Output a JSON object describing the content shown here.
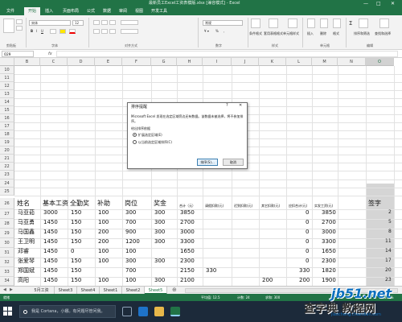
{
  "titlebar": {
    "title": "最新员工Excel工资表模版.xlsx [兼容模式] - Excel",
    "minimize": "—",
    "maximize": "□",
    "close": "✕"
  },
  "tabs": [
    "文件",
    "开始",
    "插入",
    "页面布局",
    "公式",
    "数据",
    "审阅",
    "视图",
    "开发工具"
  ],
  "ribbon": {
    "font_name": "宋体",
    "font_size": "12",
    "number_format": "常规",
    "groups": [
      "剪贴板",
      "字体",
      "对齐方式",
      "数字",
      "样式",
      "单元格",
      "编辑"
    ],
    "buttons": [
      "条件格式",
      "套用表格格式",
      "单元格样式",
      "插入",
      "删除",
      "格式",
      "排序和筛选",
      "查找和选择"
    ]
  },
  "formula_bar": {
    "name_box": "O29",
    "fx": "fx",
    "value": ""
  },
  "columns": [
    "B",
    "C",
    "D",
    "E",
    "F",
    "G",
    "H",
    "I",
    "J",
    "K",
    "L",
    "M",
    "N",
    "O"
  ],
  "selected_column": "O",
  "row_numbers": [
    "10",
    "11",
    "12",
    "13",
    "14",
    "15",
    "16",
    "17",
    "18",
    "19",
    "20",
    "21",
    "22",
    "23",
    "24",
    "25",
    "26",
    "27",
    "28",
    "29",
    "30",
    "31",
    "32",
    "33",
    "34",
    "35",
    "36",
    "37",
    "38",
    "39"
  ],
  "table_header": [
    "姓名",
    "基本工资",
    "全勤奖",
    "补助",
    "岗位",
    "奖金",
    "合计（元）",
    "请假扣款(元)",
    "迟到扣款(元)",
    "其它扣款(元)",
    "应扣合计(元)",
    "实发工资(元)",
    "",
    "签字"
  ],
  "table_rows": [
    [
      "马亚茹",
      "3000",
      "150",
      "100",
      "300",
      "300",
      "3850",
      "",
      "",
      "",
      "0",
      "3850",
      "",
      "2"
    ],
    [
      "马亚勇",
      "1450",
      "150",
      "100",
      "700",
      "300",
      "2700",
      "",
      "",
      "",
      "0",
      "2700",
      "",
      "5"
    ],
    [
      "马国鑫",
      "1450",
      "150",
      "200",
      "900",
      "300",
      "3000",
      "",
      "",
      "",
      "0",
      "3000",
      "",
      "8"
    ],
    [
      "王卫明",
      "1450",
      "150",
      "200",
      "1200",
      "300",
      "3300",
      "",
      "",
      "",
      "0",
      "3300",
      "",
      "11"
    ],
    [
      "邓睿",
      "1450",
      "0",
      "100",
      "100",
      "",
      "1650",
      "",
      "",
      "",
      "0",
      "1650",
      "",
      "14"
    ],
    [
      "张爱琴",
      "1450",
      "150",
      "100",
      "300",
      "300",
      "2300",
      "",
      "",
      "",
      "0",
      "2300",
      "",
      "17"
    ],
    [
      "郑国斌",
      "1450",
      "150",
      "",
      "700",
      "",
      "2150",
      "330",
      "",
      "",
      "330",
      "1820",
      "",
      "20"
    ],
    [
      "高阳",
      "1450",
      "150",
      "100",
      "100",
      "300",
      "2100",
      "",
      "",
      "200",
      "200",
      "1900",
      "",
      "23"
    ]
  ],
  "bottom_header_rows": [
    [
      "姓名",
      "基本工资",
      "全勤奖",
      "补助",
      "岗位",
      "奖金",
      "合计（元）",
      "请假扣款(元)",
      "迟到扣款(元)",
      "其它扣款(元)",
      "应扣合计(元)",
      "实发工资(元)"
    ],
    [
      "姓名",
      "基本工资",
      "全勤奖",
      "补助",
      "岗位",
      "奖金",
      "合计（元）",
      "请假扣款(元)",
      "迟到扣款(元)",
      "其它扣款(元)",
      "应扣合计(元)",
      "实发工资(元)"
    ]
  ],
  "dialog": {
    "title": "排序提醒",
    "help": "?",
    "close": "✕",
    "message": "Microsoft Excel 发现在选定区域旁边还有数据。该数据未被选择，将不参加排序。",
    "group_label": "给出排序依据",
    "option_expand": "扩展选定区域(E)",
    "option_current": "以当前选定区域排序(C)",
    "sort_button": "排序(S)...",
    "cancel_button": "取消"
  },
  "sheet_tabs": [
    "5月工资",
    "Sheet3",
    "Sheet4",
    "Sheet1",
    "Sheet2",
    "Sheet5"
  ],
  "active_sheet": "Sheet5",
  "status": {
    "left": "就绪",
    "avg": "平均值: 12.5",
    "count": "计数: 24",
    "sum": "求和: 300",
    "zoom": "100%"
  },
  "taskbar": {
    "cortana_placeholder": "我是 Cortana，小娜。有问题尽管问我。",
    "clock": ""
  },
  "watermark": {
    "main": "jb51.net",
    "sub": "查字典 教程网",
    "url": "jiaocheng.chazidian.com"
  },
  "colors": {
    "excel_green": "#217346",
    "taskbar": "#1c2a3a",
    "selected_col": "#d5d5d5"
  }
}
